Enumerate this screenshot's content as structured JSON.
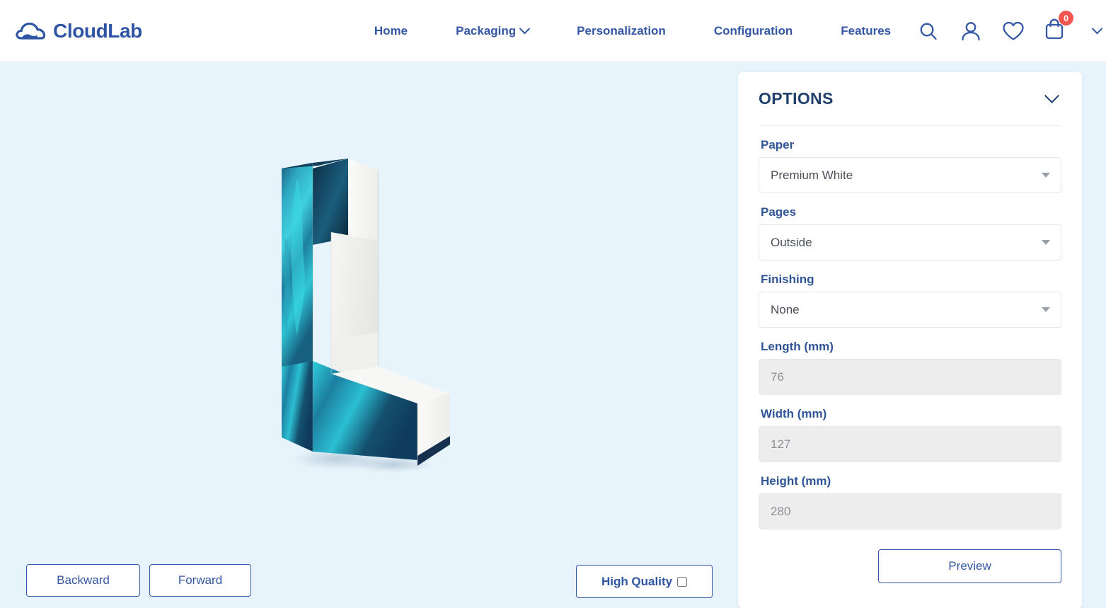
{
  "header": {
    "brand": {
      "name": "CloudLab",
      "icon": "cloud-icon"
    },
    "nav": [
      {
        "label": "Home",
        "has_caret": false
      },
      {
        "label": "Packaging",
        "has_caret": true
      },
      {
        "label": "Personalization",
        "has_caret": false
      },
      {
        "label": "Configuration",
        "has_caret": false
      },
      {
        "label": "Features",
        "has_caret": false
      }
    ],
    "icons": {
      "search": "search-icon",
      "account": "user-icon",
      "wishlist": "heart-icon",
      "cart": "shopping-bag-icon",
      "cart_count": "0",
      "cart_dropdown": "chevron-down-icon"
    },
    "colors": {
      "brand": "#2f55a4",
      "nav_link": "#3457a6",
      "badge": "#f4564f"
    }
  },
  "viewer": {
    "background_color": "#e8f4fc",
    "model_name": "unfolded-carton-3d-preview",
    "artwork_colors": [
      "#0f3b5c",
      "#1f9bb5",
      "#3ad3e0",
      "#14506e"
    ],
    "board_color": "#f2f2f0"
  },
  "controls": {
    "backward_label": "Backward",
    "forward_label": "Forward",
    "high_quality_label": "High Quality",
    "high_quality_checked": false
  },
  "options": {
    "title": "OPTIONS",
    "collapse_icon": "chevron-down-icon",
    "fields": [
      {
        "label": "Paper",
        "type": "select",
        "value": "Premium White"
      },
      {
        "label": "Pages",
        "type": "select",
        "value": "Outside"
      },
      {
        "label": "Finishing",
        "type": "select",
        "value": "None"
      },
      {
        "label": "Length (mm)",
        "type": "input",
        "value": "76",
        "disabled": true
      },
      {
        "label": "Width (mm)",
        "type": "input",
        "value": "127",
        "disabled": true
      },
      {
        "label": "Height (mm)",
        "type": "input",
        "value": "280",
        "disabled": true
      }
    ],
    "preview_label": "Preview"
  }
}
